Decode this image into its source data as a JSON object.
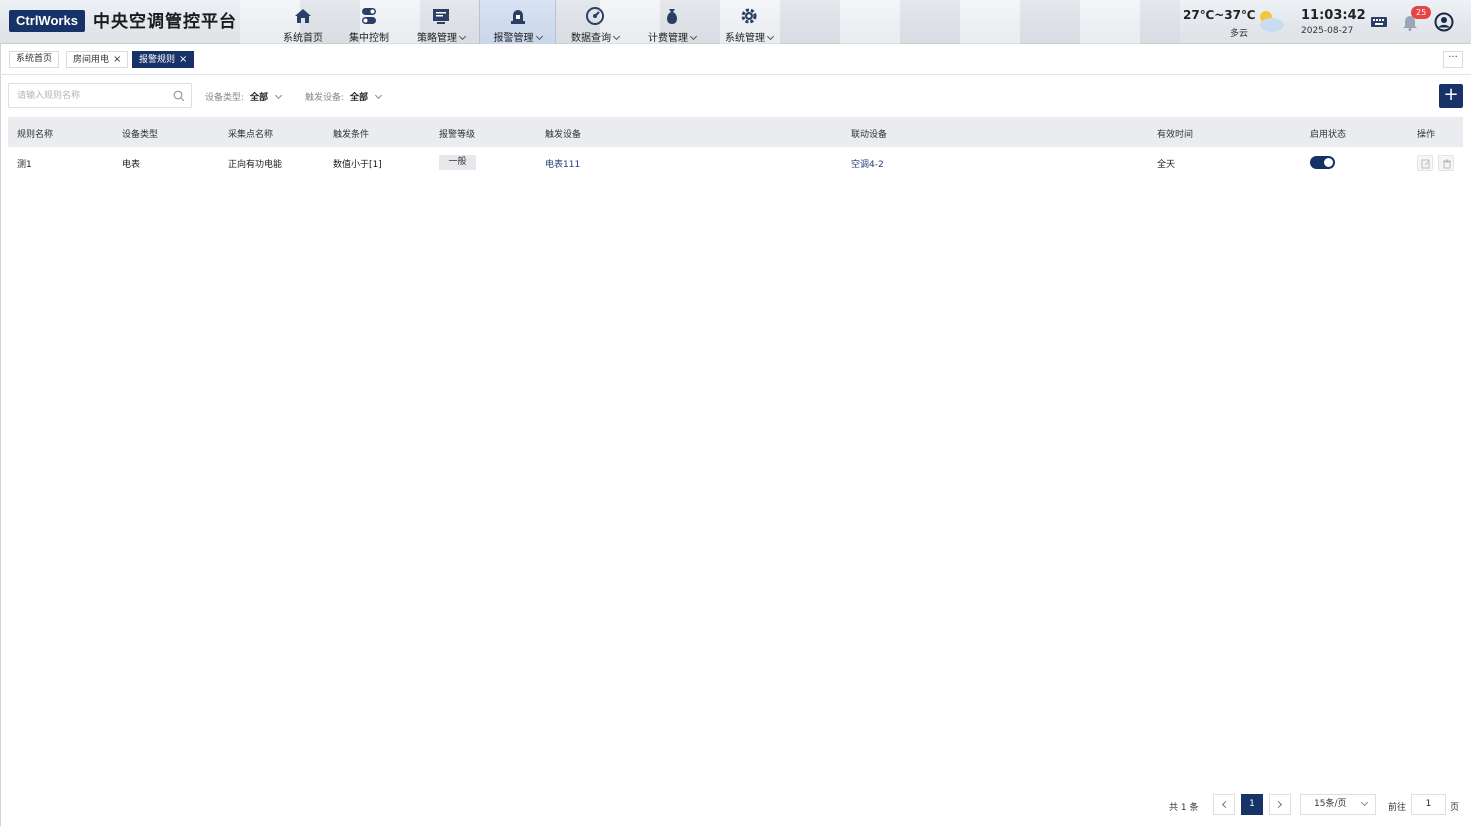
{
  "header": {
    "logo": "CtrlWorks",
    "title": "中央空调管控平台",
    "nav": [
      {
        "label": "系统首页",
        "icon": "home-icon",
        "has_menu": false
      },
      {
        "label": "集中控制",
        "icon": "toggle-icon",
        "has_menu": false
      },
      {
        "label": "策略管理",
        "icon": "strategy-icon",
        "has_menu": true
      },
      {
        "label": "报警管理",
        "icon": "alarm-icon",
        "has_menu": true,
        "active": true
      },
      {
        "label": "数据查询",
        "icon": "gauge-icon",
        "has_menu": true
      },
      {
        "label": "计费管理",
        "icon": "money-bag-icon",
        "has_menu": true
      },
      {
        "label": "系统管理",
        "icon": "gear-icon",
        "has_menu": true
      }
    ],
    "weather": {
      "temp": "27℃~37℃",
      "desc": "多云",
      "icon": "partly-cloudy-icon"
    },
    "clock": {
      "time": "11:03:42",
      "date": "2025-08-27"
    },
    "notifications": "25"
  },
  "tabs": [
    {
      "label": "系统首页",
      "closable": false
    },
    {
      "label": "房间用电",
      "closable": true
    },
    {
      "label": "报警规则",
      "closable": true,
      "active": true
    }
  ],
  "tabs_more": "···",
  "filters": {
    "search_placeholder": "请输入规则名称",
    "device_type_label": "设备类型:",
    "device_type_value": "全部",
    "trigger_device_label": "触发设备:",
    "trigger_device_value": "全部",
    "add_label": "+"
  },
  "table": {
    "columns": [
      "规则名称",
      "设备类型",
      "采集点名称",
      "触发条件",
      "报警等级",
      "触发设备",
      "联动设备",
      "有效时间",
      "启用状态",
      "操作"
    ],
    "rows": [
      {
        "name": "测1",
        "device_type": "电表",
        "point": "正向有功电能",
        "condition": "数值小于[1]",
        "level": "一般",
        "trigger_device": "电表111",
        "linked_device": "空调4-2",
        "valid_time": "全天",
        "enabled": true
      }
    ]
  },
  "pagination": {
    "total": "共 1 条",
    "current": "1",
    "page_size": "15条/页",
    "goto_label": "前往",
    "goto_value": "1",
    "page_suffix": "页"
  },
  "colors": {
    "brand": "#173266",
    "badge": "#e64545"
  }
}
